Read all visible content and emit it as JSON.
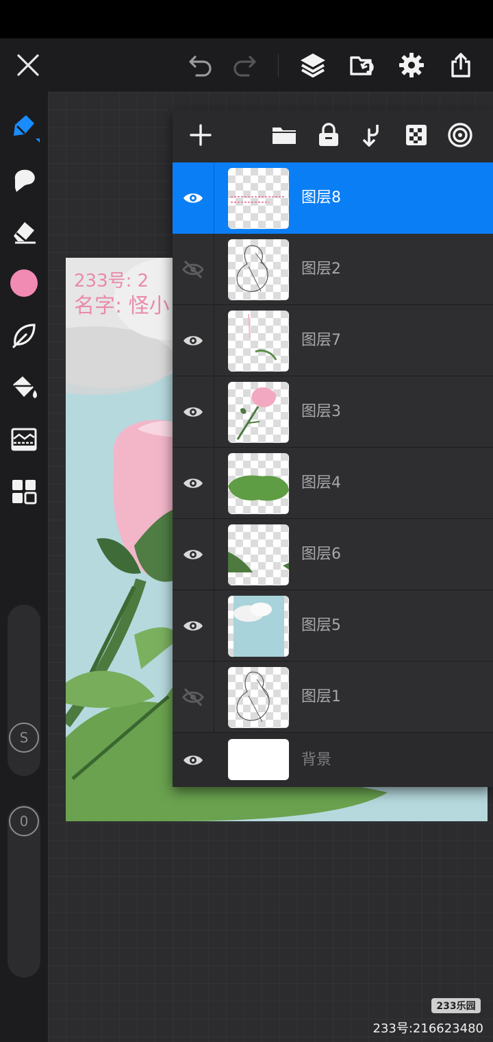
{
  "colors": {
    "accent": "#0a7ef5",
    "brush_color": "#f28bb4",
    "toolbar_bg": "#1c1c1e",
    "panel_bg": "#2a2a2c"
  },
  "topbar": {
    "icons": [
      "close-icon",
      "undo-icon",
      "redo-icon",
      "layers-icon",
      "gallery-import-icon",
      "settings-icon",
      "share-icon"
    ]
  },
  "toolbar": {
    "tools": [
      "pencil-brush-icon",
      "smudge-icon",
      "eraser-icon",
      "color-swatch",
      "leaf-brush-icon",
      "fill-bucket-icon",
      "image-adjust-icon",
      "grid-apps-icon"
    ],
    "size_slider_label": "S",
    "opacity_slider_label": "0"
  },
  "layers_panel": {
    "toolbar_icons": [
      "add-layer-icon",
      "folder-icon",
      "lock-icon",
      "merge-down-icon",
      "transparency-icon",
      "blend-mode-icon"
    ],
    "layers": [
      {
        "name": "图层8",
        "visible": true,
        "selected": true
      },
      {
        "name": "图层2",
        "visible": false,
        "selected": false
      },
      {
        "name": "图层7",
        "visible": true,
        "selected": false
      },
      {
        "name": "图层3",
        "visible": true,
        "selected": false
      },
      {
        "name": "图层4",
        "visible": true,
        "selected": false
      },
      {
        "name": "图层6",
        "visible": true,
        "selected": false
      },
      {
        "name": "图层5",
        "visible": true,
        "selected": false
      },
      {
        "name": "图层1",
        "visible": false,
        "selected": false
      },
      {
        "name": "背景",
        "visible": true,
        "selected": false
      }
    ]
  },
  "artwork": {
    "handwriting_line1": "233号: 2",
    "handwriting_line2": "名字: 怪小"
  },
  "watermark": {
    "badge": "233乐园",
    "text": "233号:216623480"
  }
}
